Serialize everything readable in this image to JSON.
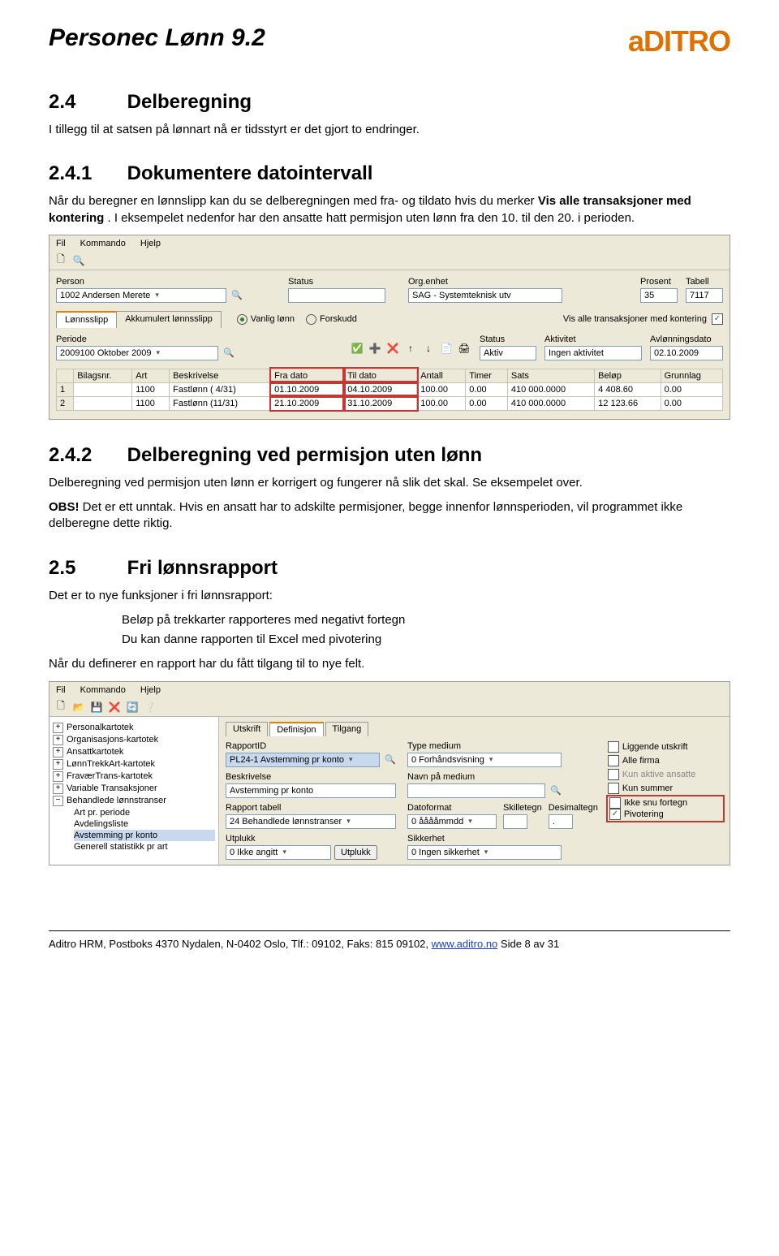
{
  "header": {
    "title": "Personec Lønn 9.2",
    "logo": "aDITRO"
  },
  "sections": {
    "s24": {
      "num": "2.4",
      "title": "Delberegning",
      "p1": "I tillegg til at satsen på lønnart nå er tidsstyrt er det gjort to endringer."
    },
    "s241": {
      "num": "2.4.1",
      "title": "Dokumentere datointervall",
      "p1_pre": "Når du beregner en lønnslipp kan du se delberegningen med fra- og tildato hvis du merker ",
      "p1_bold": "Vis alle transaksjoner med kontering",
      "p1_post": ". I eksempelet nedenfor har den ansatte hatt permisjon uten lønn fra den 10. til den 20. i perioden."
    },
    "s242": {
      "num": "2.4.2",
      "title": "Delberegning ved permisjon uten lønn",
      "p1": "Delberegning ved permisjon uten lønn er korrigert og fungerer nå slik det skal. Se eksempelet over.",
      "p2_pre": "OBS!",
      "p2_post": " Det er ett unntak. Hvis en ansatt har to adskilte permisjoner, begge innenfor lønnsperioden, vil programmet ikke delberegne dette riktig."
    },
    "s25": {
      "num": "2.5",
      "title": "Fri lønnsrapport",
      "p1": "Det er to nye funksjoner i fri lønnsrapport:",
      "b1": "Beløp på trekkarter rapporteres med negativt fortegn",
      "b2": "Du kan danne rapporten til Excel med pivotering",
      "p2": "Når du definerer en rapport har du fått tilgang til to nye felt."
    }
  },
  "app1": {
    "menu": [
      "Fil",
      "Kommando",
      "Hjelp"
    ],
    "labels": {
      "person": "Person",
      "status": "Status",
      "orgenhet": "Org.enhet",
      "prosent": "Prosent",
      "tabell": "Tabell",
      "periode": "Periode",
      "status2": "Status",
      "aktivitet": "Aktivitet",
      "avlonn": "Avlønningsdato",
      "vanlig": "Vanlig lønn",
      "forskudd": "Forskudd",
      "vis_kont": "Vis alle transaksjoner med kontering"
    },
    "tabs": {
      "lonnsslipp": "Lønnsslipp",
      "akk": "Akkumulert lønnsslipp"
    },
    "values": {
      "person": "1002 Andersen Merete",
      "status": "",
      "orgenhet": "SAG - Systemteknisk utv",
      "prosent": "35",
      "tabell": "7117",
      "periode": "2009100 Oktober 2009",
      "status2": "Aktiv",
      "aktivitet": "Ingen aktivitet",
      "avlonn": "02.10.2009"
    },
    "grid": {
      "headers": [
        "",
        "Bilagsnr.",
        "Art",
        "Beskrivelse",
        "Fra dato",
        "Til dato",
        "Antall",
        "Timer",
        "Sats",
        "Beløp",
        "Grunnlag"
      ],
      "rows": [
        [
          "1",
          "",
          "1100",
          "Fastlønn ( 4/31)",
          "01.10.2009",
          "04.10.2009",
          "100.00",
          "0.00",
          "410 000.0000",
          "4 408.60",
          "0.00"
        ],
        [
          "2",
          "",
          "1100",
          "Fastlønn (11/31)",
          "21.10.2009",
          "31.10.2009",
          "100.00",
          "0.00",
          "410 000.0000",
          "12 123.66",
          "0.00"
        ]
      ]
    },
    "icons": {
      "new": "🗋",
      "open": "🔍",
      "green": "✅",
      "add": "➕",
      "del": "❌",
      "up": "↑",
      "down": "↓",
      "copy": "📄",
      "print": "🖨"
    }
  },
  "app2": {
    "menu": [
      "Fil",
      "Kommando",
      "Hjelp"
    ],
    "tb_icons": {
      "new": "🗋",
      "open": "📂",
      "save": "💾",
      "del": "❌",
      "ref": "🔄",
      "help": "❔"
    },
    "tree": [
      {
        "t": "Personalkartotek",
        "pm": "+"
      },
      {
        "t": "Organisasjons-kartotek",
        "pm": "+"
      },
      {
        "t": "Ansattkartotek",
        "pm": "+"
      },
      {
        "t": "LønnTrekkArt-kartotek",
        "pm": "+"
      },
      {
        "t": "FraværTrans-kartotek",
        "pm": "+"
      },
      {
        "t": "Variable Transaksjoner",
        "pm": "+"
      },
      {
        "t": "Behandlede lønnstranser",
        "pm": "−",
        "sub": [
          {
            "t": "Art pr. periode"
          },
          {
            "t": "Avdelingsliste"
          },
          {
            "t": "Avstemming pr konto",
            "sel": true
          },
          {
            "t": "Generell statistikk pr art"
          }
        ]
      }
    ],
    "tabs": {
      "utskrift": "Utskrift",
      "definisjon": "Definisjon",
      "tilgang": "Tilgang"
    },
    "labels": {
      "rapportid": "RapportID",
      "typemedium": "Type medium",
      "beskrivelse": "Beskrivelse",
      "navn": "Navn på medium",
      "rapport_tabell": "Rapport tabell",
      "datoformat": "Datoformat",
      "skilletegn": "Skilletegn",
      "desimaltegn": "Desimaltegn",
      "utplukk": "Utplukk",
      "sikkerhet": "Sikkerhet"
    },
    "values": {
      "rapportid": "PL24-1 Avstemming pr konto",
      "typemedium": "0 Forhåndsvisning",
      "beskrivelse": "Avstemming pr konto",
      "navn": "",
      "rapport_tabell": "24 Behandlede lønnstranser",
      "datoformat": "0 ååååmmdd",
      "skilletegn": "",
      "desimaltegn": ".",
      "utplukk": "0 Ikke angitt",
      "utplukk2": "Utplukk",
      "sikkerhet": "0 Ingen sikkerhet"
    },
    "opts": {
      "ligg": "Liggende utskrift",
      "alle": "Alle firma",
      "kun_aktive": "Kun aktive ansatte",
      "kun_summer": "Kun summer",
      "ikke_snu": "Ikke snu fortegn",
      "pivot": "Pivotering"
    }
  },
  "footer": {
    "text_pre": "Aditro HRM, Postboks 4370 Nydalen, N-0402 Oslo, Tlf.: 09102, Faks: 815 09102, ",
    "link": "www.aditro.no",
    "text_post": " Side 8 av 31"
  }
}
